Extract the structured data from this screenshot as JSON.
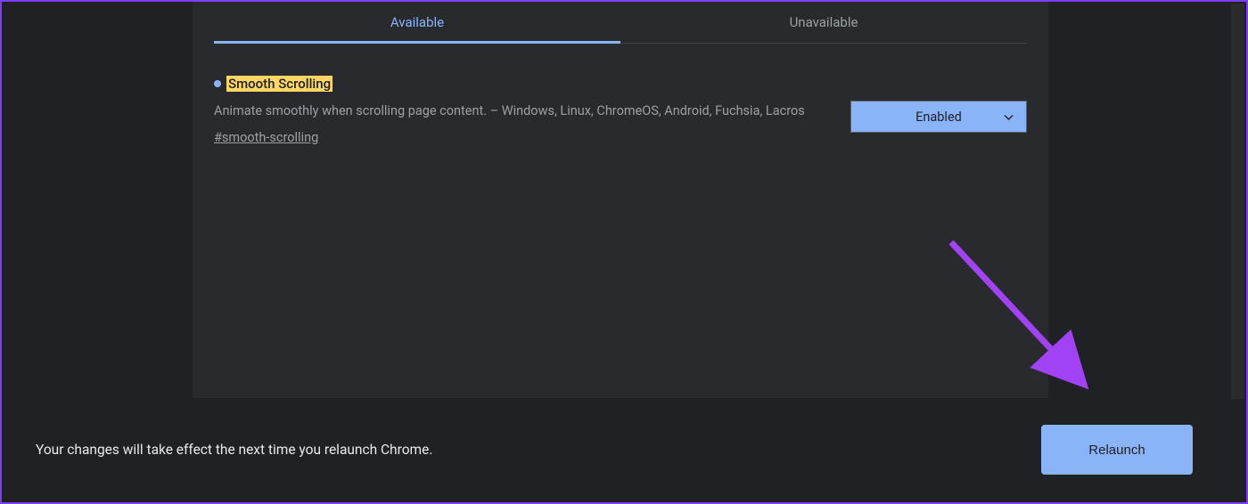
{
  "tabs": {
    "available": "Available",
    "unavailable": "Unavailable"
  },
  "flag": {
    "title": "Smooth Scrolling",
    "description": "Animate smoothly when scrolling page content. – Windows, Linux, ChromeOS, Android, Fuchsia, Lacros",
    "hash": "#smooth-scrolling",
    "selected_value": "Enabled"
  },
  "relaunch_bar": {
    "message": "Your changes will take effect the next time you relaunch Chrome.",
    "button_label": "Relaunch"
  }
}
